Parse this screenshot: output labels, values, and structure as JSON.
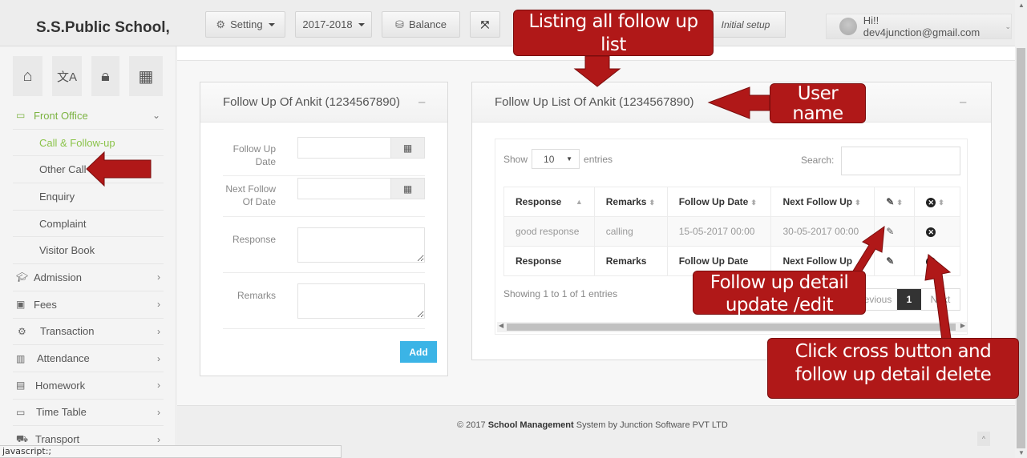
{
  "header": {
    "school_name": "S.S.Public School,",
    "setting_label": "Setting",
    "session_label": "2017-2018",
    "balance_label": "Balance",
    "initial_setup_label": "Initial setup",
    "user_greeting": "Hi!! dev4junction@gmail.com",
    "icons": {
      "setting": "gear-icon",
      "balance": "database-icon",
      "fullscreen": "expand-icon"
    }
  },
  "sidebar": {
    "quick_icons": [
      "home-icon",
      "language-icon",
      "lock-icon",
      "calendar-icon"
    ],
    "items": [
      {
        "label": "Front Office",
        "icon": "desktop-icon",
        "state": "expanded"
      },
      {
        "label": "Call & Follow-up",
        "sub": true,
        "state": "current"
      },
      {
        "label": "Other Call",
        "sub": true
      },
      {
        "label": "Enquiry",
        "sub": true
      },
      {
        "label": "Complaint",
        "sub": true
      },
      {
        "label": "Visitor Book",
        "sub": true
      },
      {
        "label": "Admission",
        "icon": "graduation-cap-icon"
      },
      {
        "label": "Fees",
        "icon": "money-icon"
      },
      {
        "label": "Transaction",
        "icon": "gear-icon"
      },
      {
        "label": "Attendance",
        "icon": "bar-chart-icon"
      },
      {
        "label": "Homework",
        "icon": "document-icon"
      },
      {
        "label": "Time Table",
        "icon": "calendar-icon"
      },
      {
        "label": "Transport",
        "icon": "bus-icon"
      }
    ]
  },
  "form_panel": {
    "title": "Follow Up Of Ankit (1234567890)",
    "collapse": "–",
    "fields": {
      "follow_up_date": {
        "label": "Follow Up Date",
        "value": ""
      },
      "next_follow_date": {
        "label": "Next Follow Of Date",
        "value": ""
      },
      "response": {
        "label": "Response",
        "value": ""
      },
      "remarks": {
        "label": "Remarks",
        "value": ""
      }
    },
    "add_label": "Add"
  },
  "list_panel": {
    "title": "Follow Up List Of Ankit (1234567890)",
    "collapse": "–",
    "show_label": "Show",
    "entries_label": "entries",
    "page_length": "10",
    "search_label": "Search:",
    "search_value": "",
    "columns": [
      "Response",
      "Remarks",
      "Follow Up Date",
      "Next Follow Up"
    ],
    "rows": [
      {
        "response": "good response",
        "remarks": "calling",
        "follow_up_date": "15-05-2017 00:00",
        "next_follow_up": "30-05-2017 00:00"
      }
    ],
    "footer_columns": [
      "Response",
      "Remarks",
      "Follow Up Date",
      "Next Follow Up"
    ],
    "info": "Showing 1 to 1 of 1 entries",
    "pagination": {
      "previous": "Previous",
      "current": "1",
      "next": "Next"
    }
  },
  "footer": {
    "prefix": "© 2017 ",
    "bold": "School Management",
    "suffix": " System by Junction Software PVT LTD"
  },
  "statusbar": {
    "text": "javascript:;"
  },
  "annotations": {
    "listing": "Listing all follow up list",
    "user_name": "User name",
    "edit": "Follow up detail update /edit",
    "delete": "Click cross button and follow up detail delete",
    "color": "#b01818"
  }
}
